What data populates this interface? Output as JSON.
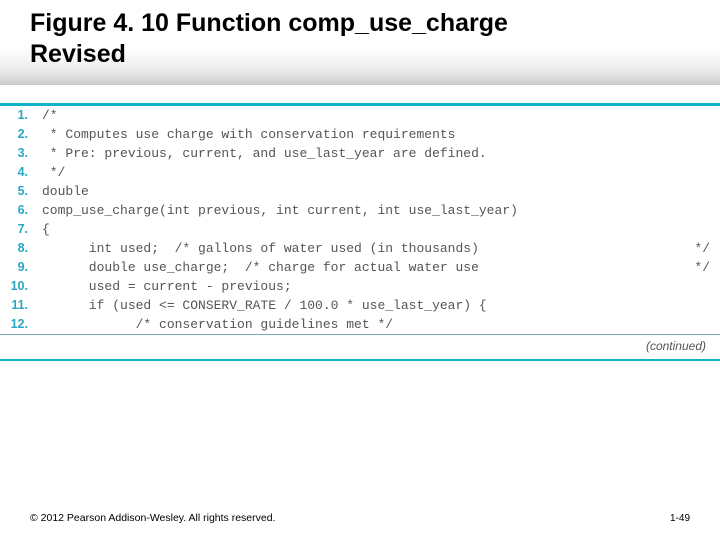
{
  "title_line1": "Figure 4. 10  Function comp_use_charge",
  "title_line2": "Revised",
  "code": {
    "lines": [
      {
        "n": "1.",
        "text": "/*"
      },
      {
        "n": "2.",
        "text": " * Computes use charge with conservation requirements"
      },
      {
        "n": "3.",
        "text": " * Pre: previous, current, and use_last_year are defined."
      },
      {
        "n": "4.",
        "text": " */"
      },
      {
        "n": "5.",
        "text": "double"
      },
      {
        "n": "6.",
        "text": "comp_use_charge(int previous, int current, int use_last_year)"
      },
      {
        "n": "7.",
        "text": "{"
      },
      {
        "n": "8.",
        "text": "      int used;  /* gallons of water used (in thousands)",
        "rcomment": "*/"
      },
      {
        "n": "9.",
        "text": "      double use_charge;  /* charge for actual water use",
        "rcomment": "*/"
      },
      {
        "n": "10.",
        "text": "      used = current - previous;"
      },
      {
        "n": "11.",
        "text": "      if (used <= CONSERV_RATE / 100.0 * use_last_year) {"
      },
      {
        "n": "12.",
        "text": "            /* conservation guidelines met */"
      }
    ]
  },
  "continued": "(continued)",
  "copyright": "© 2012 Pearson Addison-Wesley. All rights reserved.",
  "pagenum": "1-49"
}
